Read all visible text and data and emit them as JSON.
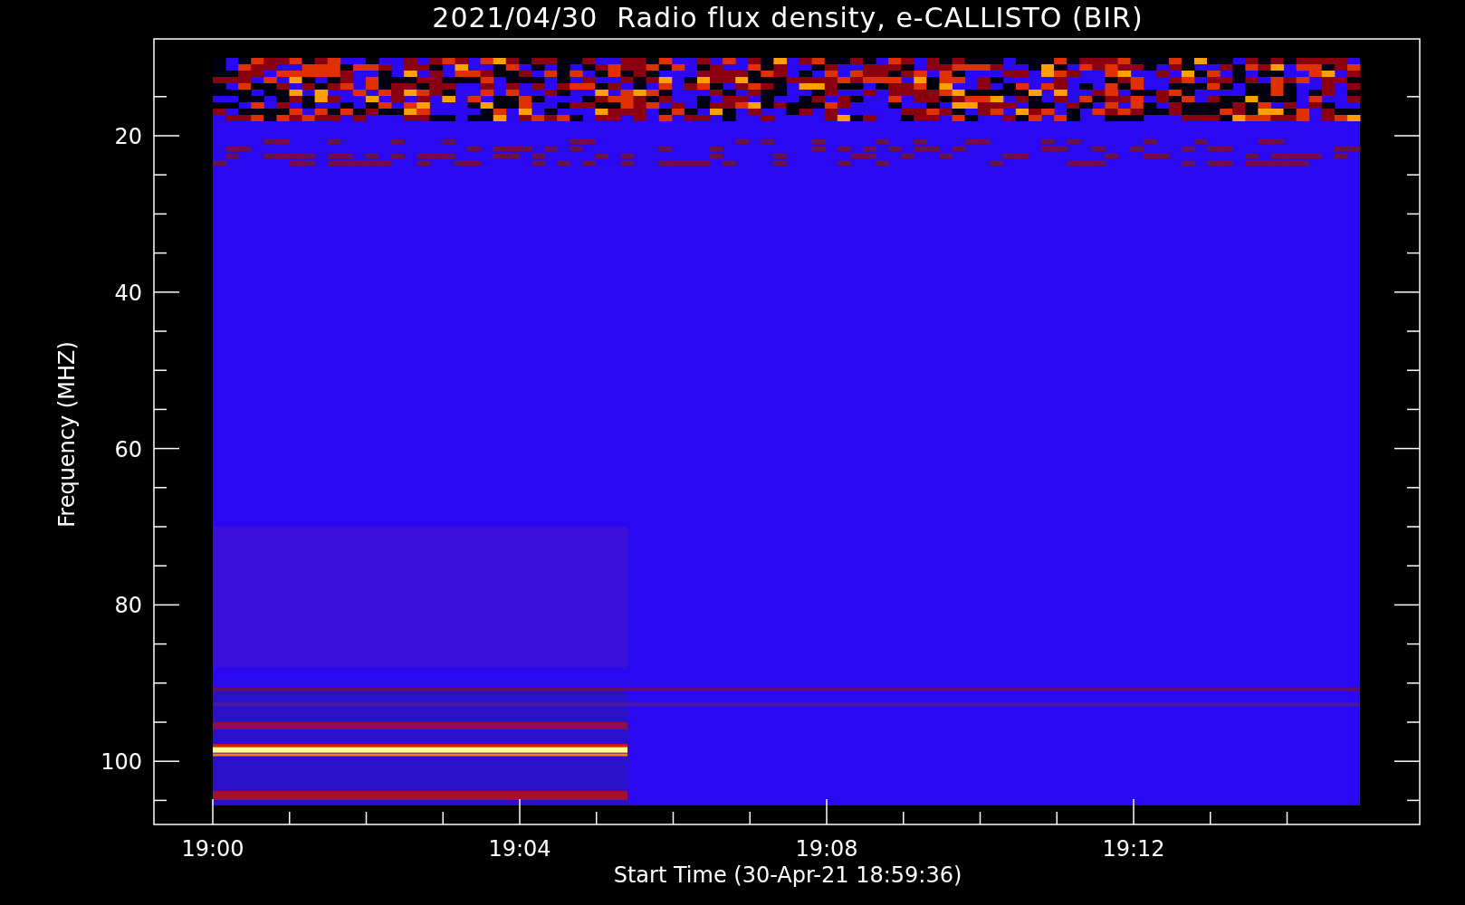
{
  "title": "2021/04/30  Radio flux density, e-CALLISTO (BIR)",
  "y_axis": {
    "label": "Frequency (MHZ)",
    "ticks": [
      "20",
      "40",
      "60",
      "80",
      "100"
    ]
  },
  "x_axis": {
    "label": "Start Time (30-Apr-21 18:59:36)",
    "ticks": [
      "19:00",
      "19:04",
      "19:08",
      "19:12"
    ]
  }
}
